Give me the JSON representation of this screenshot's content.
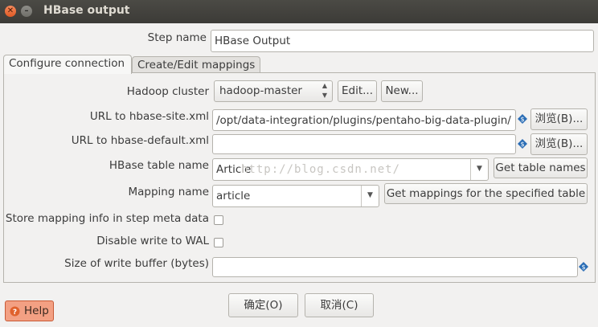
{
  "window": {
    "title": "HBase output",
    "close_glyph": "✕",
    "minimize_glyph": "–"
  },
  "step": {
    "label": "Step name",
    "value": "HBase Output"
  },
  "tabs": [
    {
      "label": "Configure connection",
      "active": true
    },
    {
      "label": "Create/Edit mappings",
      "active": false
    }
  ],
  "config": {
    "hadoop_cluster": {
      "label": "Hadoop cluster",
      "value": "hadoop-master",
      "edit_label": "Edit...",
      "new_label": "New..."
    },
    "site_xml": {
      "label": "URL to hbase-site.xml",
      "value": "/opt/data-integration/plugins/pentaho-big-data-plugin/",
      "browse_label": "浏览(B)..."
    },
    "default_xml": {
      "label": "URL to hbase-default.xml",
      "value": "",
      "browse_label": "浏览(B)..."
    },
    "table_name": {
      "label": "HBase table name",
      "value": "Article",
      "button_label": "Get table names"
    },
    "mapping_name": {
      "label": "Mapping name",
      "value": "article",
      "button_label": "Get mappings for the specified table"
    },
    "store_mapping": {
      "label": "Store mapping info in step meta data",
      "checked": false
    },
    "disable_wal": {
      "label": "Disable write to WAL",
      "checked": false
    },
    "write_buffer": {
      "label": "Size of write buffer (bytes)",
      "value": ""
    }
  },
  "watermark": "http://blog.csdn.net/",
  "footer": {
    "ok_label": "确定(O)",
    "cancel_label": "取消(C)",
    "help_label": "Help"
  },
  "colors": {
    "accent": "#e0622d",
    "variable_icon": "#2a6db5"
  }
}
